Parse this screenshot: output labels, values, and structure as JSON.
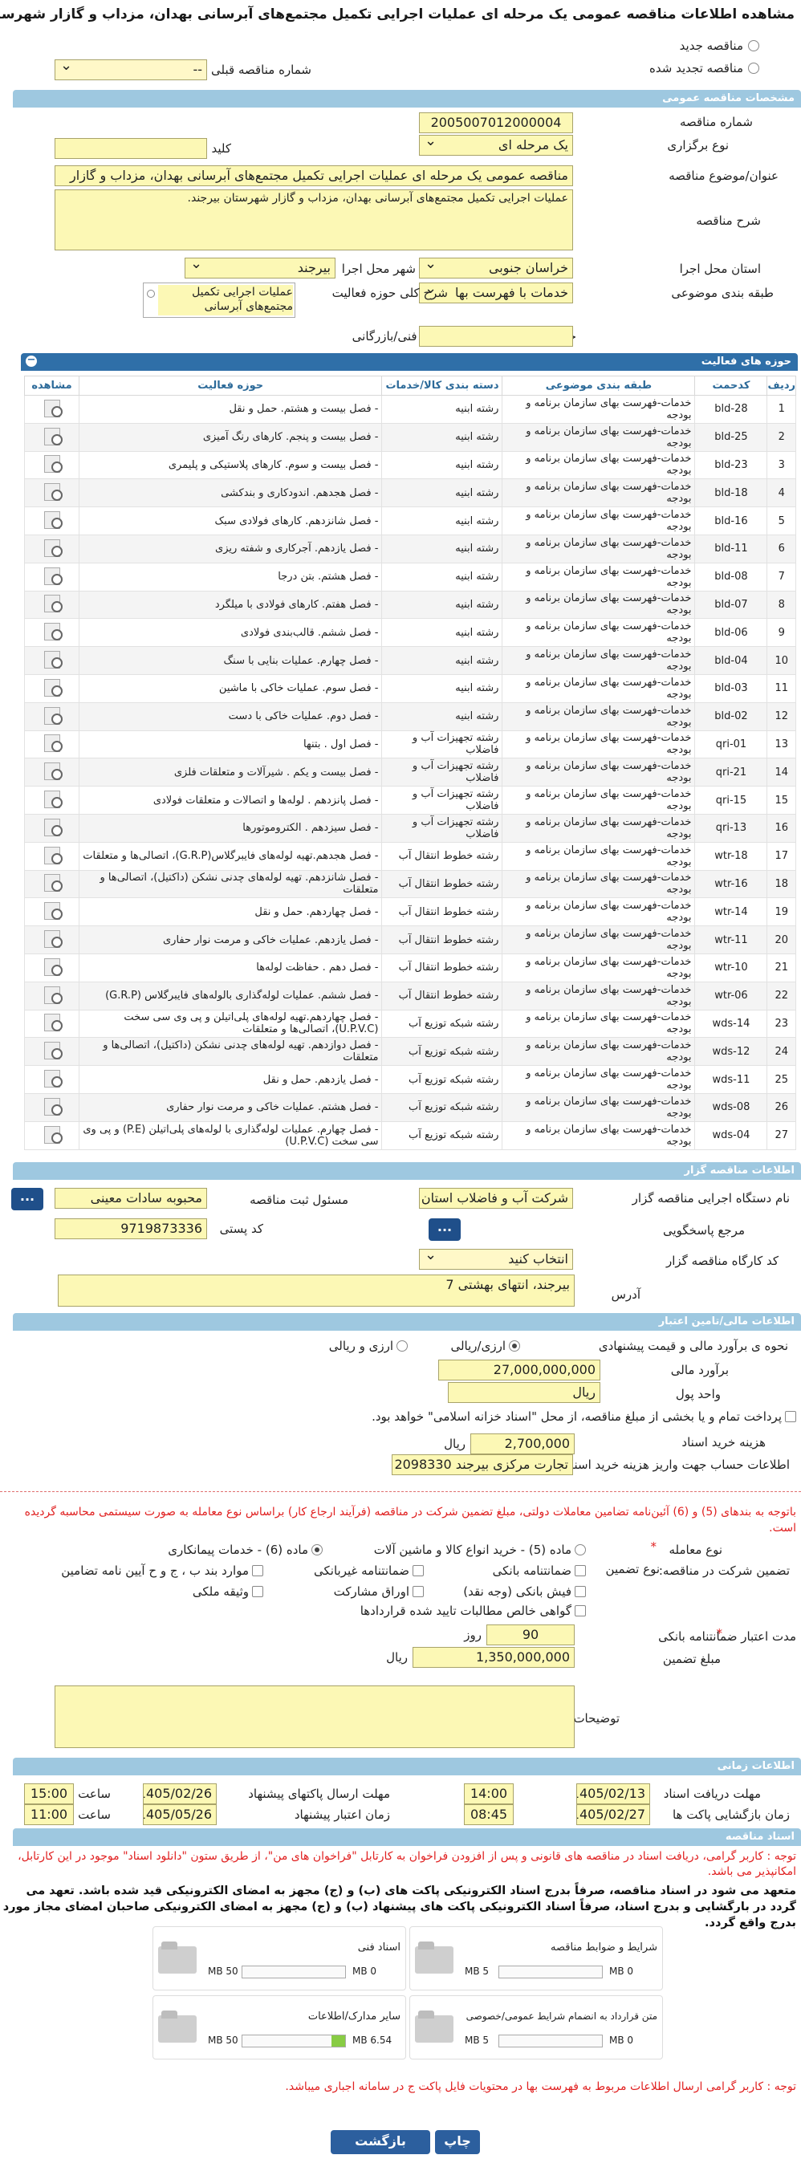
{
  "page_title": "مشاهده اطلاعات مناقصه عمومی یک مرحله ای عملیات اجرایی تکمیل مجتمع‌های آبرسانی بهدان، مزداب و گازار شهرستان بیرجند.",
  "top": {
    "new_tender": "مناقصه جدید",
    "renewed_tender": "مناقصه تجدید شده",
    "prev_tender_label": "شماره مناقصه قبلی",
    "prev_tender_value": "--"
  },
  "general": {
    "header": "مشخصات مناقصه عمومی",
    "number_label": "شماره مناقصه",
    "number_value": "2005007012000004",
    "type_label": "نوع برگزاری",
    "type_value": "یک مرحله ای",
    "keyword_label": "کلید واژه",
    "keyword_value": "",
    "subject_label": "عنوان/موضوع مناقصه",
    "subject_value": "مناقصه عمومی یک مرحله ای عملیات اجرایی تکمیل مجتمع‌های آبرسانی بهدان، مزداب و گازار",
    "desc_label": "شرح مناقصه",
    "desc_value": "عملیات اجرایی تکمیل مجتمع‌های آبرسانی بهدان، مزداب و گازار شهرستان بیرجند.",
    "province_label": "استان محل اجرا",
    "province_value": "خراسان جنوبی",
    "city_label": "شهر محل اجرا",
    "city_value": "بیرجند",
    "subject_cat_label": "طبقه بندی موضوعی",
    "subject_cat_value": "خدمات با فهرست بها",
    "scope_label": "شرح کلی حوزه فعالیت",
    "scope_value": "عملیات اجرایی تکمیل مجتمع‌های آبرسانی",
    "min_score_label": "حداقل امتیاز قابل قبول ارزیابی فنی/بازرگانی",
    "min_score_value": ""
  },
  "activities": {
    "header": "حوزه های فعالیت",
    "columns": [
      "ردیف",
      "کدحمت",
      "طبقه بندی موضوعی",
      "دسته بندی کالا/خدمات",
      "حوزه فعالیت",
      "مشاهده"
    ],
    "rows": [
      [
        "1",
        "bld-28",
        "خدمات-فهرست بهای سازمان برنامه و بودجه",
        "رشته ابنیه",
        "- فصل بیست و هشتم. حمل و نقل"
      ],
      [
        "2",
        "bld-25",
        "خدمات-فهرست بهای سازمان برنامه و بودجه",
        "رشته ابنیه",
        "- فصل بیست و پنجم. کارهای رنگ آمیزی"
      ],
      [
        "3",
        "bld-23",
        "خدمات-فهرست بهای سازمان برنامه و بودجه",
        "رشته ابنیه",
        "- فصل بیست و سوم. کارهای پلاستیکی و پلیمری"
      ],
      [
        "4",
        "bld-18",
        "خدمات-فهرست بهای سازمان برنامه و بودجه",
        "رشته ابنیه",
        "- فصل هجدهم. اندودکاری و بندکشی"
      ],
      [
        "5",
        "bld-16",
        "خدمات-فهرست بهای سازمان برنامه و بودجه",
        "رشته ابنیه",
        "- فصل شانزدهم. کارهای فولادی سبک"
      ],
      [
        "6",
        "bld-11",
        "خدمات-فهرست بهای سازمان برنامه و بودجه",
        "رشته ابنیه",
        "- فصل یازدهم. آجرکاری و شفته ریزی"
      ],
      [
        "7",
        "bld-08",
        "خدمات-فهرست بهای سازمان برنامه و بودجه",
        "رشته ابنیه",
        "- فصل هشتم. بتن درجا"
      ],
      [
        "8",
        "bld-07",
        "خدمات-فهرست بهای سازمان برنامه و بودجه",
        "رشته ابنیه",
        "- فصل هفتم. کارهای فولادی با میلگرد"
      ],
      [
        "9",
        "bld-06",
        "خدمات-فهرست بهای سازمان برنامه و بودجه",
        "رشته ابنیه",
        "- فصل ششم. قالب‌بندی فولادی"
      ],
      [
        "10",
        "bld-04",
        "خدمات-فهرست بهای سازمان برنامه و بودجه",
        "رشته ابنیه",
        "- فصل چهارم. عملیات بنایی با سنگ"
      ],
      [
        "11",
        "bld-03",
        "خدمات-فهرست بهای سازمان برنامه و بودجه",
        "رشته ابنیه",
        "- فصل سوم. عملیات خاکی با ماشین"
      ],
      [
        "12",
        "bld-02",
        "خدمات-فهرست بهای سازمان برنامه و بودجه",
        "رشته ابنیه",
        "- فصل دوم. عملیات خاکی با دست"
      ],
      [
        "13",
        "qri-01",
        "خدمات-فهرست بهای سازمان برنامه و بودجه",
        "رشته تجهیزات آب و فاضلاب",
        "- فصل اول . بتنها"
      ],
      [
        "14",
        "qri-21",
        "خدمات-فهرست بهای سازمان برنامه و بودجه",
        "رشته تجهیزات آب و فاضلاب",
        "- فصل بیست و یکم . شیرآلات و متعلقات فلزی"
      ],
      [
        "15",
        "qri-15",
        "خدمات-فهرست بهای سازمان برنامه و بودجه",
        "رشته تجهیزات آب و فاضلاب",
        "- فصل پانزدهم . لوله‌ها و اتصالات و متعلقات فولادی"
      ],
      [
        "16",
        "qri-13",
        "خدمات-فهرست بهای سازمان برنامه و بودجه",
        "رشته تجهیزات آب و فاضلاب",
        "- فصل سیزدهم . الکتروموتورها"
      ],
      [
        "17",
        "wtr-18",
        "خدمات-فهرست بهای سازمان برنامه و بودجه",
        "رشته خطوط انتقال آب",
        "- فصل هجدهم.تهیه لوله‌های فایبرگلاس(G.R.P)، اتصالی‌ها و متعلقات"
      ],
      [
        "18",
        "wtr-16",
        "خدمات-فهرست بهای سازمان برنامه و بودجه",
        "رشته خطوط انتقال آب",
        "- فصل شانزدهم. تهیه لوله‌های چدنی نشکن (داکتیل)، اتصالی‌ها و متعلقات"
      ],
      [
        "19",
        "wtr-14",
        "خدمات-فهرست بهای سازمان برنامه و بودجه",
        "رشته خطوط انتقال آب",
        "- فصل چهاردهم. حمل و نقل"
      ],
      [
        "20",
        "wtr-11",
        "خدمات-فهرست بهای سازمان برنامه و بودجه",
        "رشته خطوط انتقال آب",
        "- فصل یازدهم. عملیات خاکی و مرمت نوار حفاری"
      ],
      [
        "21",
        "wtr-10",
        "خدمات-فهرست بهای سازمان برنامه و بودجه",
        "رشته خطوط انتقال آب",
        "- فصل دهم . حفاظت لوله‌ها"
      ],
      [
        "22",
        "wtr-06",
        "خدمات-فهرست بهای سازمان برنامه و بودجه",
        "رشته خطوط انتقال آب",
        "- فصل ششم. عملیات لوله‌گذاری بالوله‌های فایبرگلاس (G.R.P)"
      ],
      [
        "23",
        "wds-14",
        "خدمات-فهرست بهای سازمان برنامه و بودجه",
        "رشته شبکه توزیع آب",
        "- فصل چهاردهم.تهیه لوله‌های پلی‌اتیلن و پی وی سی سخت (U.P.V.C)، اتصالی‌ها و متعلقات"
      ],
      [
        "24",
        "wds-12",
        "خدمات-فهرست بهای سازمان برنامه و بودجه",
        "رشته شبکه توزیع آب",
        "- فصل دوازدهم. تهیه لوله‌های چدنی نشکن (داکتیل)، اتصالی‌ها و متعلقات"
      ],
      [
        "25",
        "wds-11",
        "خدمات-فهرست بهای سازمان برنامه و بودجه",
        "رشته شبکه توزیع آب",
        "- فصل یازدهم. حمل و نقل"
      ],
      [
        "26",
        "wds-08",
        "خدمات-فهرست بهای سازمان برنامه و بودجه",
        "رشته شبکه توزیع آب",
        "- فصل هشتم. عملیات خاکی و مرمت نوار حفاری"
      ],
      [
        "27",
        "wds-04",
        "خدمات-فهرست بهای سازمان برنامه و بودجه",
        "رشته شبکه توزیع آب",
        "- فصل چهارم. عملیات لوله‌گذاری با لوله‌های پلی‌اتیلن (P.E) و پی وی سی سخت (U.P.V.C)"
      ]
    ]
  },
  "organizer": {
    "header": "اطلاعات مناقصه گزار",
    "org_label": "نام دستگاه اجرایی مناقصه گزار",
    "org_value": "شرکت آب و فاضلاب استان",
    "resp_label": "مسئول ثبت مناقصه",
    "resp_value": "محبوبه سادات معینی",
    "ref_label": "مرجع پاسخگویی",
    "postal_label": "کد پستی",
    "postal_value": "9719873336",
    "workshop_label": "کد کارگاه مناقصه گزار",
    "workshop_value": "انتخاب کنید",
    "address_label": "آدرس",
    "address_value": "بیرجند، انتهای بهشتی 7",
    "dots": "..."
  },
  "financial": {
    "header": "اطلاعات مالی/تامین اعتبار",
    "estimate_label": "نحوه ی برآورد مالی و قیمت پیشنهادی",
    "opt_rial": "ارزی/ریالی",
    "opt_fx": "ارزی و ریالی",
    "estimate_amount_label": "برآورد مالی",
    "estimate_amount_value": "27,000,000,000",
    "unit_label": "واحد پول",
    "unit_value": "ریال",
    "treasury_note": "پرداخت تمام و یا بخشی از مبلغ مناقصه، از محل \"اسناد خزانه اسلامی\" خواهد بود.",
    "doc_fee_label": "هزینه خرید اسناد",
    "doc_fee_value": "2,700,000",
    "doc_fee_unit": "ریال",
    "account_label": "اطلاعات حساب جهت واریز هزینه خرید اسناد",
    "account_value": "تجارت مرکزی بیرجند 2098330"
  },
  "guarantee": {
    "red_note": "باتوجه به بندهای (5) و (6) آئین‌نامه تضامین معاملات دولتی، مبلغ تضمین شرکت در مناقصه (فرآیند ارجاع کار) براساس نوع معامله به صورت سیستمی محاسبه گردیده است.",
    "deal_type_label": "نوع معامله",
    "opt5": "ماده (5) - خرید انواع کالا و ماشین آلات",
    "opt6": "ماده (6) - خدمات پیمانکاری",
    "guarantee_label": "تضمین شرکت در مناقصه:",
    "gtype_label": "نوع تضمین",
    "g1": "ضمانتنامه بانکی",
    "g2": "ضمانتنامه غیربانکی",
    "g3": "موارد بند ب ، ج و ح آیین نامه تضامین",
    "g4": "فیش بانکی (وجه نقد)",
    "g5": "اوراق مشارکت",
    "g6": "وثیقه ملکی",
    "g7": "گواهی خالص مطالبات تایید شده قراردادها",
    "validity_label": "مدت اعتبار ضمانتنامه بانکی",
    "validity_value": "90",
    "validity_unit": "روز",
    "amount_label": "مبلغ تضمین",
    "amount_value": "1,350,000,000",
    "amount_unit": "ریال",
    "desc_label": "توضیحات",
    "desc_value": ""
  },
  "timing": {
    "header": "اطلاعات زمانی",
    "doc_receive_label": "مهلت دریافت اسناد",
    "doc_receive_date": "1405/02/13",
    "doc_receive_time": "14:00",
    "send_label": "مهلت ارسال پاکتهای پیشنهاد",
    "send_date": "1405/02/26",
    "send_time": "15:00",
    "open_label": "زمان بازگشایی پاکت ها",
    "open_date": "1405/02/27",
    "open_time": "08:45",
    "valid_label": "زمان اعتبار پیشنهاد",
    "valid_date": "1405/05/26",
    "valid_time": "11:00",
    "time_label": "ساعت"
  },
  "docs": {
    "header": "اسناد مناقصه",
    "note1": "توجه : کاربر گرامی، دریافت اسناد در مناقصه های قانونی و پس از افزودن فراخوان به کارتابل \"فراخوان های من\"، از طریق ستون \"دانلود اسناد\" موجود در این کارتابل، امکانپذیر می باشد.",
    "note2": "متعهد می شود در اسناد مناقصه، صرفاً بدرج اسناد الکترونیکی پاکت های (ب) و (ج) مجهز به امضای الکترونیکی قید شده باشد. تعهد می گردد در بارگشایی و بدرج اسناد، صرفاً اسناد الکترونیکی پاکت های پیشنهاد (ب) و (ج) مجهز به امضای الکترونیکی صاحبان امضای مجاز مورد بدرج واقع گردد.",
    "files": [
      {
        "title": "شرایط و ضوابط مناقصه",
        "used": "0 MB",
        "total": "5 MB",
        "fill": 0
      },
      {
        "title": "اسناد فنی",
        "used": "0 MB",
        "total": "50 MB",
        "fill": 0
      },
      {
        "title": "متن قرارداد به انضمام شرایط عمومی/خصوصی",
        "used": "0 MB",
        "total": "5 MB",
        "fill": 0
      },
      {
        "title": "سایر مدارک/اطلاعات",
        "used": "6.54 MB",
        "total": "50 MB",
        "fill": 0.13
      }
    ],
    "note3": "توجه : کاربر گرامی ارسال اطلاعات مربوط به فهرست بها در محتویات فایل پاکت ج در سامانه اجباری میباشد."
  },
  "buttons": {
    "print": "چاپ",
    "back": "بازگشت"
  },
  "colors": {
    "section": "#9ec8e0",
    "field": "#fcf8b5",
    "button": "#2c5f9e",
    "red": "#e02020"
  }
}
